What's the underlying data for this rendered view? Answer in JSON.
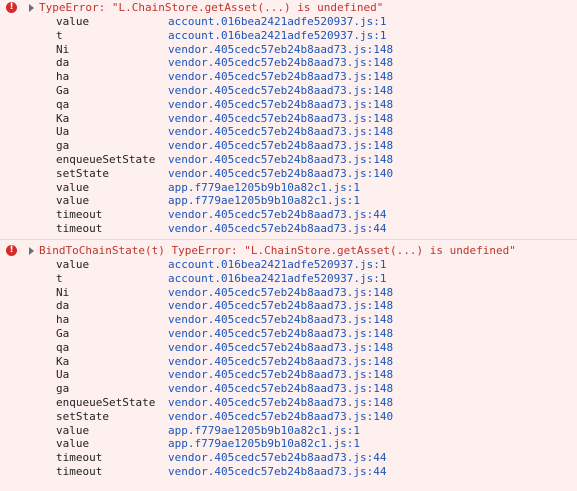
{
  "colors": {
    "background": "#fff0f0",
    "error_text": "#c0342c",
    "link": "#1a55b8",
    "error_icon": "#d62b2b"
  },
  "icons": {
    "error": "error-circle-icon",
    "expand": "triangle-right-icon"
  },
  "entries": [
    {
      "icon_glyph": "!",
      "message": "TypeError: \"L.ChainStore.getAsset(...) is undefined\"",
      "frames": [
        {
          "fn": "value",
          "loc": "account.016bea2421adfe520937.js:1"
        },
        {
          "fn": "t",
          "loc": "account.016bea2421adfe520937.js:1"
        },
        {
          "fn": "Ni",
          "loc": "vendor.405cedc57eb24b8aad73.js:148"
        },
        {
          "fn": "da",
          "loc": "vendor.405cedc57eb24b8aad73.js:148"
        },
        {
          "fn": "ha",
          "loc": "vendor.405cedc57eb24b8aad73.js:148"
        },
        {
          "fn": "Ga",
          "loc": "vendor.405cedc57eb24b8aad73.js:148"
        },
        {
          "fn": "qa",
          "loc": "vendor.405cedc57eb24b8aad73.js:148"
        },
        {
          "fn": "Ka",
          "loc": "vendor.405cedc57eb24b8aad73.js:148"
        },
        {
          "fn": "Ua",
          "loc": "vendor.405cedc57eb24b8aad73.js:148"
        },
        {
          "fn": "ga",
          "loc": "vendor.405cedc57eb24b8aad73.js:148"
        },
        {
          "fn": "enqueueSetState",
          "loc": "vendor.405cedc57eb24b8aad73.js:148"
        },
        {
          "fn": "setState",
          "loc": "vendor.405cedc57eb24b8aad73.js:140"
        },
        {
          "fn": "value",
          "loc": "app.f779ae1205b9b10a82c1.js:1"
        },
        {
          "fn": "value",
          "loc": "app.f779ae1205b9b10a82c1.js:1"
        },
        {
          "fn": "timeout",
          "loc": "vendor.405cedc57eb24b8aad73.js:44"
        },
        {
          "fn": "timeout",
          "loc": "vendor.405cedc57eb24b8aad73.js:44"
        }
      ]
    },
    {
      "icon_glyph": "!",
      "message": "BindToChainState(t) TypeError: \"L.ChainStore.getAsset(...) is undefined\"",
      "frames": [
        {
          "fn": "value",
          "loc": "account.016bea2421adfe520937.js:1"
        },
        {
          "fn": "t",
          "loc": "account.016bea2421adfe520937.js:1"
        },
        {
          "fn": "Ni",
          "loc": "vendor.405cedc57eb24b8aad73.js:148"
        },
        {
          "fn": "da",
          "loc": "vendor.405cedc57eb24b8aad73.js:148"
        },
        {
          "fn": "ha",
          "loc": "vendor.405cedc57eb24b8aad73.js:148"
        },
        {
          "fn": "Ga",
          "loc": "vendor.405cedc57eb24b8aad73.js:148"
        },
        {
          "fn": "qa",
          "loc": "vendor.405cedc57eb24b8aad73.js:148"
        },
        {
          "fn": "Ka",
          "loc": "vendor.405cedc57eb24b8aad73.js:148"
        },
        {
          "fn": "Ua",
          "loc": "vendor.405cedc57eb24b8aad73.js:148"
        },
        {
          "fn": "ga",
          "loc": "vendor.405cedc57eb24b8aad73.js:148"
        },
        {
          "fn": "enqueueSetState",
          "loc": "vendor.405cedc57eb24b8aad73.js:148"
        },
        {
          "fn": "setState",
          "loc": "vendor.405cedc57eb24b8aad73.js:140"
        },
        {
          "fn": "value",
          "loc": "app.f779ae1205b9b10a82c1.js:1"
        },
        {
          "fn": "value",
          "loc": "app.f779ae1205b9b10a82c1.js:1"
        },
        {
          "fn": "timeout",
          "loc": "vendor.405cedc57eb24b8aad73.js:44"
        },
        {
          "fn": "timeout",
          "loc": "vendor.405cedc57eb24b8aad73.js:44"
        }
      ]
    }
  ]
}
